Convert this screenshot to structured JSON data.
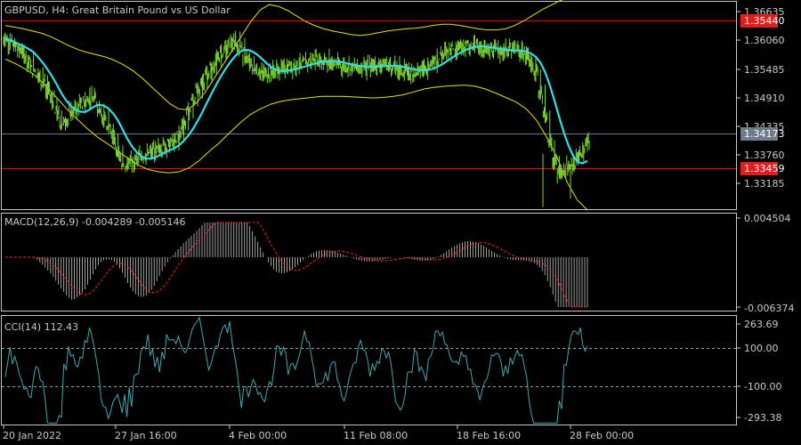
{
  "symbol": "GBPUSD",
  "timeframe": "H4",
  "description": "Great Britain Pound vs US Dollar",
  "price_title": "GBPUSD, H4:  Great Britain Pound vs US Dollar",
  "colors": {
    "background": "#000000",
    "frame": "#c8c8c8",
    "candle": "#7cd631",
    "bollinger": "#e6e600",
    "moving_average": "#33dde6",
    "level_line": "#ff0000",
    "level_label_bg": "#e11d1d",
    "current_price_bg": "#6e7c8a",
    "current_price_line": "#6e7c8a",
    "macd_histogram": "#c8c8c8",
    "macd_signal": "#ff2020",
    "cci_line": "#3aaab0",
    "cci_levels": "#a0a0a0"
  },
  "price_axis": {
    "ticks": [
      "1.36635",
      "1.36060",
      "1.35485",
      "1.34910",
      "1.34335",
      "1.33760",
      "1.33185"
    ],
    "current_price": "1.34173",
    "levels": [
      "1.35440",
      "1.33459"
    ]
  },
  "macd": {
    "title": "MACD(12,26,9) -0.004289 -0.005146",
    "axis_top": "0.004504",
    "axis_bottom": "-0.006374"
  },
  "cci": {
    "title": "CCI(14) 112.43",
    "axis_labels": [
      "263.69",
      "100.00",
      "-100.00",
      "-293.38"
    ]
  },
  "time_axis": [
    "20 Jan 2022",
    "27 Jan 16:00",
    "4 Feb 00:00",
    "11 Feb 08:00",
    "18 Feb 16:00",
    "28 Feb 00:00"
  ],
  "chart_data": [
    {
      "type": "candlestick",
      "title": "GBPUSD, H4:  Great Britain Pound vs US Dollar",
      "ylim": [
        1.33,
        1.367
      ],
      "levels": [
        1.3544,
        1.33459
      ],
      "current_price": 1.34173,
      "close": [
        1.3605,
        1.3598,
        1.3592,
        1.3583,
        1.3575,
        1.3562,
        1.355,
        1.354,
        1.3528,
        1.351,
        1.3495,
        1.347,
        1.3455,
        1.346,
        1.3475,
        1.348,
        1.3488,
        1.3492,
        1.35,
        1.3495,
        1.348,
        1.3462,
        1.3445,
        1.3425,
        1.3405,
        1.3388,
        1.338,
        1.3385,
        1.339,
        1.3395,
        1.3398,
        1.3402,
        1.3406,
        1.341,
        1.3415,
        1.3418,
        1.342,
        1.3435,
        1.3455,
        1.3475,
        1.3495,
        1.3512,
        1.3528,
        1.354,
        1.3552,
        1.3565,
        1.3578,
        1.3588,
        1.3596,
        1.3598,
        1.3592,
        1.3575,
        1.356,
        1.355,
        1.3545,
        1.3542,
        1.3544,
        1.3547,
        1.3549,
        1.3551,
        1.3553,
        1.3555,
        1.3557,
        1.356,
        1.3563,
        1.3566,
        1.3568,
        1.3567,
        1.3565,
        1.3562,
        1.356,
        1.3558,
        1.3556,
        1.3555,
        1.3554,
        1.3553,
        1.3553,
        1.3554,
        1.3556,
        1.3558,
        1.3559,
        1.3558,
        1.3556,
        1.3553,
        1.3549,
        1.3546,
        1.3544,
        1.3545,
        1.3548,
        1.3552,
        1.3557,
        1.3563,
        1.357,
        1.3576,
        1.3582,
        1.3587,
        1.359,
        1.3592,
        1.3593,
        1.3593,
        1.3591,
        1.3589,
        1.3586,
        1.3584,
        1.3583,
        1.3583,
        1.3582,
        1.3584,
        1.3585,
        1.3584,
        1.358,
        1.3572,
        1.356,
        1.354,
        1.351,
        1.347,
        1.342,
        1.3385,
        1.3368,
        1.337,
        1.3375,
        1.3382,
        1.3395,
        1.3405,
        1.3417
      ],
      "bollinger_upper": [
        1.3628,
        1.3625,
        1.3622,
        1.3618,
        1.3614,
        1.3608,
        1.36,
        1.3592,
        1.3585,
        1.358,
        1.3576,
        1.3572,
        1.3566,
        1.3558,
        1.3548,
        1.3535,
        1.352,
        1.3505,
        1.349,
        1.348,
        1.3478,
        1.349,
        1.351,
        1.3535,
        1.356,
        1.3585,
        1.361,
        1.3635,
        1.3655,
        1.3665,
        1.3662,
        1.3655,
        1.3645,
        1.3635,
        1.3628,
        1.3622,
        1.3618,
        1.3615,
        1.3612,
        1.361,
        1.3612,
        1.3615,
        1.3618,
        1.362,
        1.3622,
        1.3623,
        1.3625,
        1.3628,
        1.363,
        1.363,
        1.3628,
        1.3625,
        1.3622,
        1.362,
        1.362,
        1.3622,
        1.3628,
        1.3636,
        1.3646,
        1.3656,
        1.3664,
        1.3672,
        1.3678,
        1.3681,
        1.3675
      ],
      "bollinger_lower": [
        1.3568,
        1.356,
        1.355,
        1.3538,
        1.352,
        1.35,
        1.348,
        1.3462,
        1.3445,
        1.343,
        1.3418,
        1.3405,
        1.3392,
        1.338,
        1.3372,
        1.3368,
        1.3366,
        1.3368,
        1.3375,
        1.3388,
        1.3405,
        1.342,
        1.3438,
        1.3455,
        1.347,
        1.348,
        1.3488,
        1.3493,
        1.3496,
        1.3498,
        1.35,
        1.3502,
        1.3502,
        1.3502,
        1.3501,
        1.35,
        1.3499,
        1.35,
        1.3502,
        1.3505,
        1.351,
        1.3515,
        1.3518,
        1.352,
        1.3521,
        1.3522,
        1.352,
        1.3515,
        1.3508,
        1.35,
        1.3492,
        1.348,
        1.346,
        1.343,
        1.3395,
        1.335,
        1.3318,
        1.33
      ],
      "cci_levels": [
        100,
        -100
      ],
      "macd_last": -0.004289,
      "signal_last": -0.005146,
      "cci_last": 112.43
    }
  ]
}
